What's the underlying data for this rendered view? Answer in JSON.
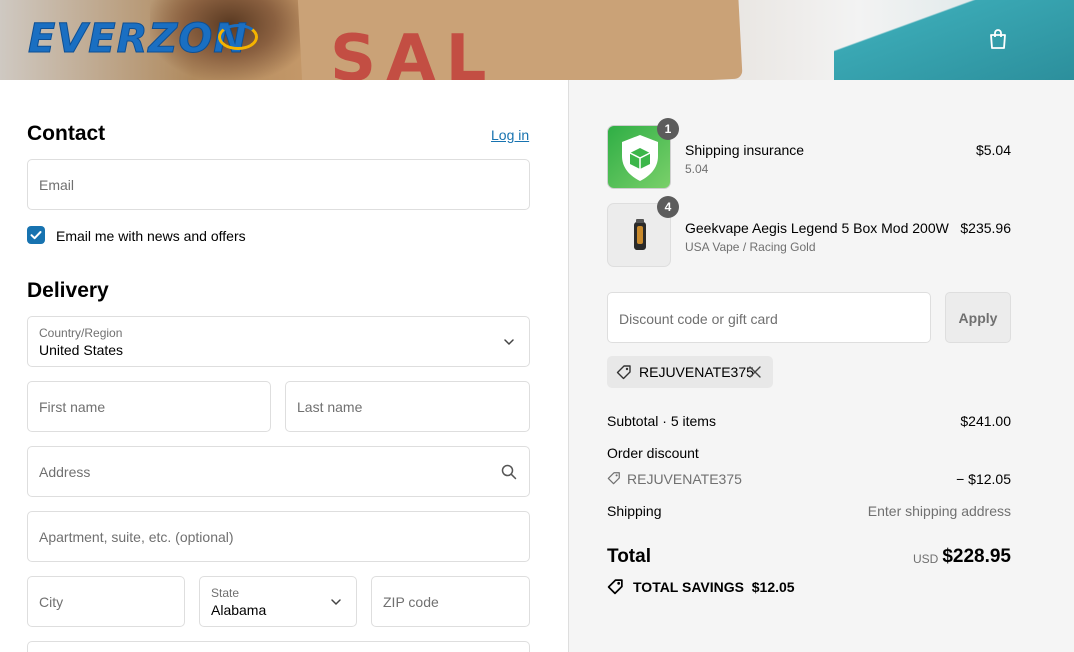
{
  "header": {
    "logo_text": "EVERZON",
    "cart_icon": "shopping-bag-icon"
  },
  "contact": {
    "title": "Contact",
    "login_label": "Log in",
    "email_placeholder": "Email",
    "newsletter_label": "Email me with news and offers",
    "newsletter_checked": true
  },
  "delivery": {
    "title": "Delivery",
    "country_label": "Country/Region",
    "country_value": "United States",
    "first_name_placeholder": "First name",
    "last_name_placeholder": "Last name",
    "address_placeholder": "Address",
    "apartment_placeholder": "Apartment, suite, etc. (optional)",
    "city_placeholder": "City",
    "state_label": "State",
    "state_value": "Alabama",
    "zip_placeholder": "ZIP code"
  },
  "cart": {
    "items": [
      {
        "name": "Shipping insurance",
        "variant": "5.04",
        "price": "$5.04",
        "quantity": "1",
        "icon": "shield-box-icon"
      },
      {
        "name": "Geekvape Aegis Legend 5 Box Mod 200W",
        "variant": "USA Vape / Racing Gold",
        "price": "$235.96",
        "quantity": "4",
        "icon": "vape-mod-icon"
      }
    ],
    "discount_placeholder": "Discount code or gift card",
    "apply_label": "Apply",
    "applied_code": "REJUVENATE375"
  },
  "summary": {
    "subtotal_label": "Subtotal · 5 items",
    "subtotal_value": "$241.00",
    "order_discount_label": "Order discount",
    "discount_code": "REJUVENATE375",
    "discount_value": "− $12.05",
    "shipping_label": "Shipping",
    "shipping_value": "Enter shipping address",
    "total_label": "Total",
    "currency": "USD",
    "total_value": "$228.95",
    "savings_label": "TOTAL SAVINGS  $12.05"
  },
  "colors": {
    "accent": "#1773b0",
    "brand": "#1a6fc2",
    "insurance_green": "#3cb64a"
  }
}
